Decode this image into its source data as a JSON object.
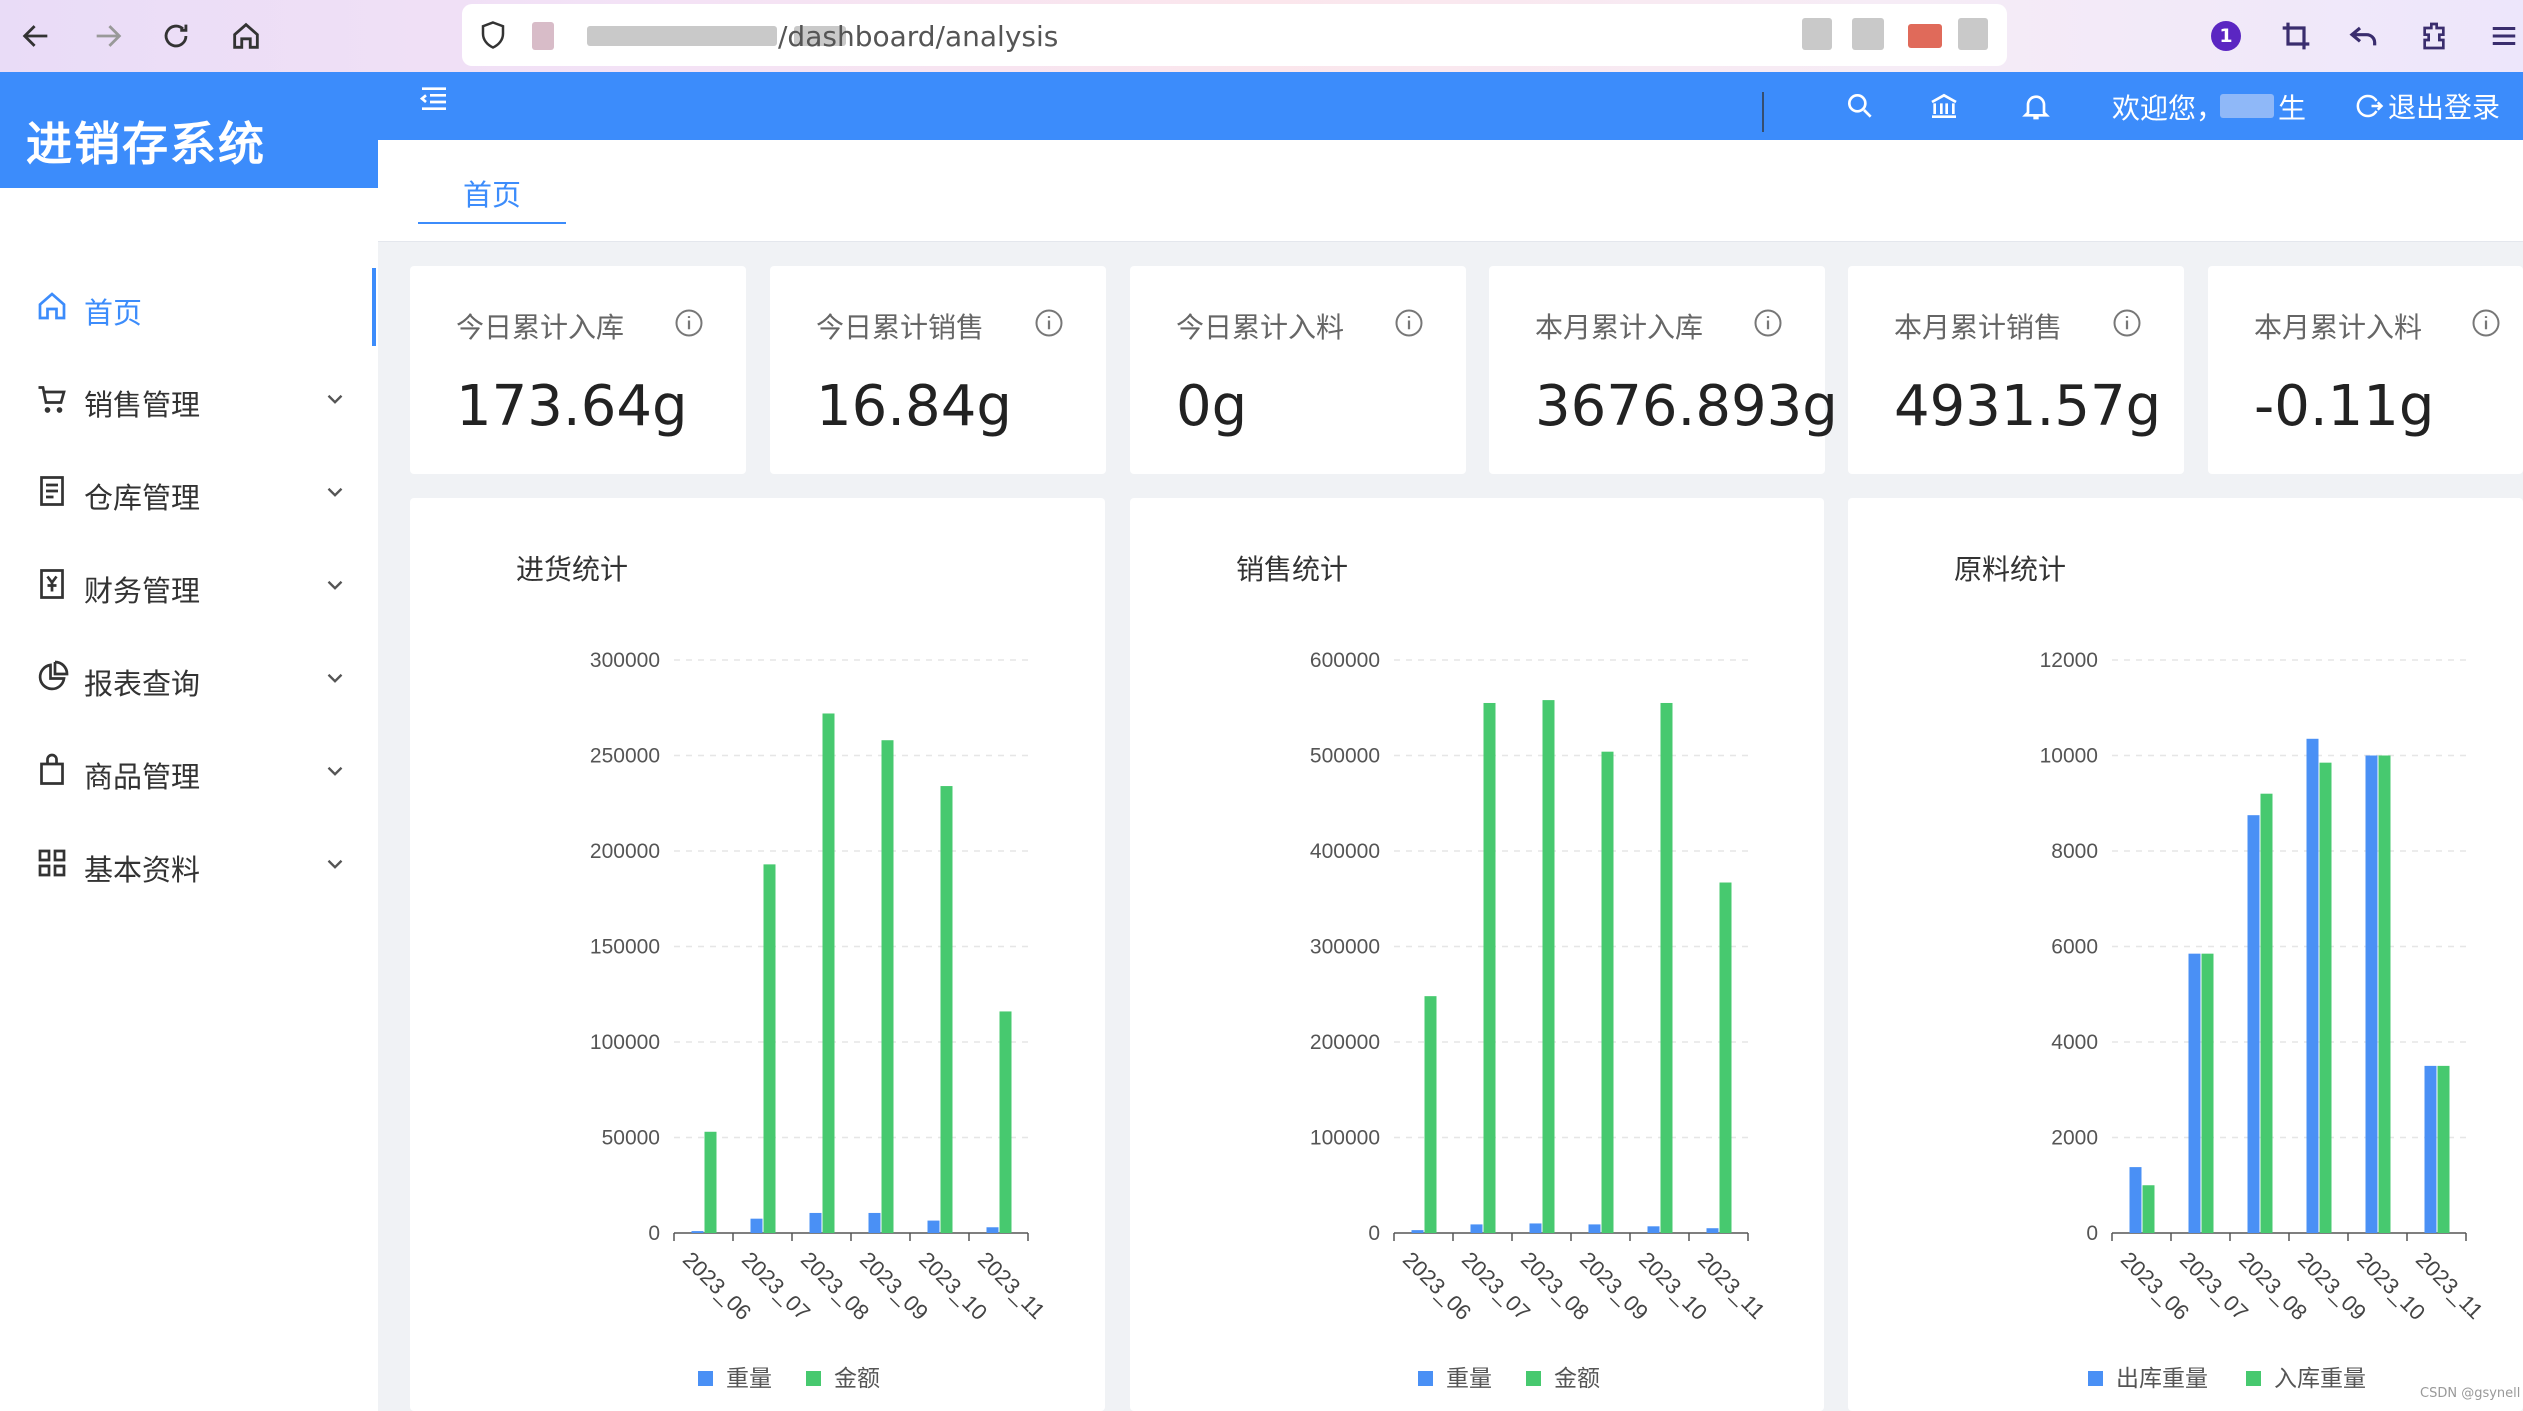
{
  "browser": {
    "url_path": "/dashboard/analysis",
    "extension_badge": "1"
  },
  "app": {
    "title": "进销存系统",
    "welcome": "欢迎您，",
    "user_suffix": "生",
    "logout": "退出登录"
  },
  "sidebar": {
    "items": [
      {
        "label": "首页",
        "icon": "home-icon"
      },
      {
        "label": "销售管理",
        "icon": "cart-icon"
      },
      {
        "label": "仓库管理",
        "icon": "warehouse-icon"
      },
      {
        "label": "财务管理",
        "icon": "finance-icon"
      },
      {
        "label": "报表查询",
        "icon": "pie-chart-icon"
      },
      {
        "label": "商品管理",
        "icon": "bag-icon"
      },
      {
        "label": "基本资料",
        "icon": "grid-icon"
      }
    ]
  },
  "tabs": [
    {
      "label": "首页"
    }
  ],
  "stats": [
    {
      "title": "今日累计入库",
      "value": "173.64g"
    },
    {
      "title": "今日累计销售",
      "value": "16.84g"
    },
    {
      "title": "今日累计入料",
      "value": "0g"
    },
    {
      "title": "本月累计入库",
      "value": "3676.893g"
    },
    {
      "title": "本月累计销售",
      "value": "4931.57g"
    },
    {
      "title": "本月累计入料",
      "value": "-0.11g"
    }
  ],
  "colors": {
    "primary": "#3c8cfb",
    "series_blue": "#4a90f5",
    "series_green": "#47c96f"
  },
  "watermark": "CSDN @gsynell",
  "chart_data": [
    {
      "type": "bar",
      "title": "进货统计",
      "categories": [
        "2023_06",
        "2023_07",
        "2023_08",
        "2023_09",
        "2023_10",
        "2023_11"
      ],
      "series": [
        {
          "name": "重量",
          "values": [
            1000,
            7500,
            10500,
            10500,
            6500,
            3000
          ]
        },
        {
          "name": "金额",
          "values": [
            53000,
            193000,
            272000,
            258000,
            234000,
            116000
          ]
        }
      ],
      "ylim": [
        0,
        300000
      ],
      "yticks": [
        0,
        50000,
        100000,
        150000,
        200000,
        250000,
        300000
      ]
    },
    {
      "type": "bar",
      "title": "销售统计",
      "categories": [
        "2023_06",
        "2023_07",
        "2023_08",
        "2023_09",
        "2023_10",
        "2023_11"
      ],
      "series": [
        {
          "name": "重量",
          "values": [
            3000,
            9000,
            10000,
            9000,
            7000,
            5000
          ]
        },
        {
          "name": "金额",
          "values": [
            248000,
            555000,
            558000,
            504000,
            555000,
            367000
          ]
        }
      ],
      "ylim": [
        0,
        600000
      ],
      "yticks": [
        0,
        100000,
        200000,
        300000,
        400000,
        500000,
        600000
      ]
    },
    {
      "type": "bar",
      "title": "原料统计",
      "categories": [
        "2023_06",
        "2023_07",
        "2023_08",
        "2023_09",
        "2023_10",
        "2023_11"
      ],
      "series": [
        {
          "name": "出库重量",
          "values": [
            1380,
            5850,
            8750,
            10350,
            10000,
            3500
          ]
        },
        {
          "name": "入库重量",
          "values": [
            1000,
            5850,
            9200,
            9850,
            10000,
            3500
          ]
        }
      ],
      "ylim": [
        0,
        12000
      ],
      "yticks": [
        0,
        2000,
        4000,
        6000,
        8000,
        10000,
        12000
      ]
    }
  ]
}
